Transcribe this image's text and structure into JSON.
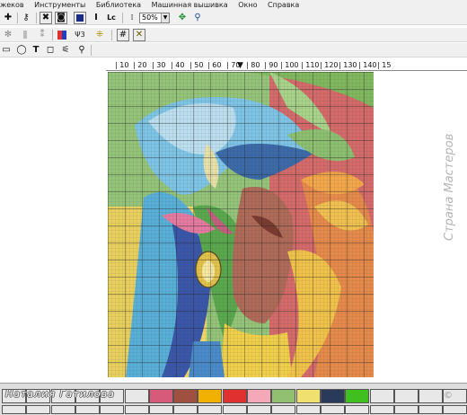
{
  "menu": [
    "жеков",
    "Инструменты",
    "Библиотека",
    "Машинная вышивка",
    "Окно",
    "Справка"
  ],
  "toolbar": {
    "zoom_value": "50%",
    "letter_i": "I",
    "letter_lc": "Lc",
    "letter_t": "T"
  },
  "ruler": {
    "ticks": [
      "| 10",
      "| 20",
      "| 30",
      "| 40",
      "| 50",
      "| 60",
      "| 70",
      "| 80",
      "| 90",
      "| 100",
      "| 110",
      "| 120",
      "| 130",
      "| 140",
      "| 15"
    ],
    "current_col": "70"
  },
  "palette": {
    "author_name": "Наталия Гатилова",
    "colors_row1": [
      "#e8e8e8",
      "#e8e8e8",
      "#e8e8e8",
      "#e8e8e8",
      "#e8e8e8",
      "#e8e8e8",
      "#d85a7a",
      "#a05040",
      "#f2b000",
      "#e03030",
      "#f4a8b8",
      "#90c070",
      "#f0e070",
      "#2a3a5a",
      "#40c020",
      "#e8e8e8",
      "#e8e8e8",
      "#e8e8e8",
      "#e8e8e8"
    ],
    "colors_row2": [
      "#e8e8e8",
      "#e8e8e8",
      "#e8e8e8",
      "#e8e8e8",
      "#e8e8e8",
      "#e8e8e8",
      "#e8e8e8",
      "#e8e8e8",
      "#e8e8e8",
      "#e8e8e8",
      "#e8e8e8",
      "#e8e8e8",
      "#e8e8e8",
      "#e8e8e8",
      "#e8e8e8",
      "#e8e8e8",
      "#e8e8e8",
      "#e8e8e8",
      "#e8e8e8"
    ]
  },
  "watermark": {
    "text": "Страна Мастеров",
    "copyright": "©"
  }
}
